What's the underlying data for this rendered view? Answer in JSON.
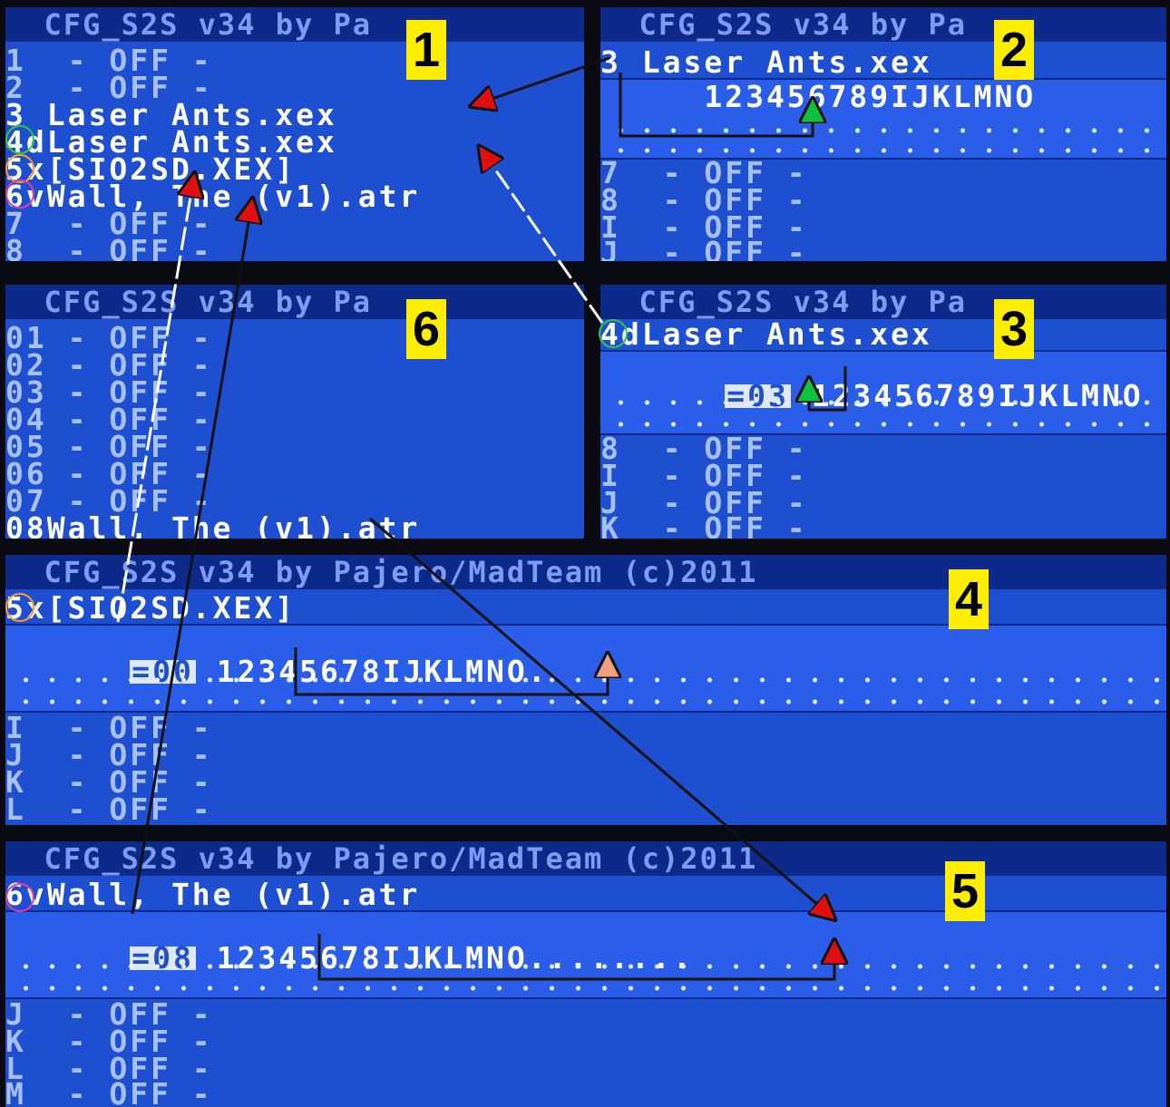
{
  "colors": {
    "screen_bg": "#1d4fd0",
    "title_bg": "#0d2a8a",
    "text": "#a9c0ff",
    "label_bg": "#ffee00",
    "ring_green": "#35c935",
    "ring_orange": "#ff9a2e",
    "ring_pink": "#e040a0",
    "arrow": "#111111",
    "tip_red": "#e01010",
    "tip_green": "#10c040",
    "tip_peach": "#f0a080"
  },
  "screens": {
    "s1": {
      "label": "1",
      "title": "  CFG_S2S v34 by Pa",
      "rows": [
        "1  - OFF -",
        "2  - OFF -",
        "3 Laser Ants.xex",
        "4dLaser Ants.xex",
        "5x[SIO2SD.XEX]",
        "6vWall, The (v1).atr",
        "7  - OFF -",
        "8  - OFF -"
      ]
    },
    "s2": {
      "label": "2",
      "title": "  CFG_S2S v34 by Pa",
      "rows_top": [
        "3 Laser Ants.xex"
      ],
      "edit": "     123456789IJKLMNO",
      "rows_bottom": [
        "7  - OFF -",
        "8  - OFF -",
        "I  - OFF -",
        "J  - OFF -"
      ]
    },
    "s3": {
      "label": "3",
      "title": "  CFG_S2S v34 by Pa",
      "rows_top": [
        "4dLaser Ants.xex"
      ],
      "edit_prefix": "=03",
      "edit": " 123456789IJKLMNO",
      "rows_bottom": [
        "8  - OFF -",
        "I  - OFF -",
        "J  - OFF -",
        "K  - OFF -"
      ]
    },
    "s4": {
      "label": "4",
      "title": "  CFG_S2S v34 by Pajero/MadTeam (c)2011",
      "rows_top": [
        "5x[SIO2SD.XEX]"
      ],
      "edit_prefix": "=00",
      "edit": " 12345678IJKLMNO.",
      "rows_bottom": [
        "I  - OFF -",
        "J  - OFF -",
        "K  - OFF -",
        "L  - OFF -"
      ]
    },
    "s5": {
      "label": "5",
      "title": "  CFG_S2S v34 by Pajero/MadTeam (c)2011",
      "rows_top": [
        "6vWall, The (v1).atr"
      ],
      "edit_prefix": "=08",
      "edit": " 12345678IJKLMNO........",
      "rows_bottom": [
        "J  - OFF -",
        "K  - OFF -",
        "L  - OFF -",
        "M  - OFF -"
      ]
    },
    "s6": {
      "label": "6",
      "title": "  CFG_S2S v34 by Pa",
      "rows": [
        "01 - OFF -",
        "02 - OFF -",
        "03 - OFF -",
        "04 - OFF -",
        "05 - OFF -",
        "06 - OFF -",
        "07 - OFF -",
        "08Wall, The (v1).atr"
      ]
    }
  }
}
